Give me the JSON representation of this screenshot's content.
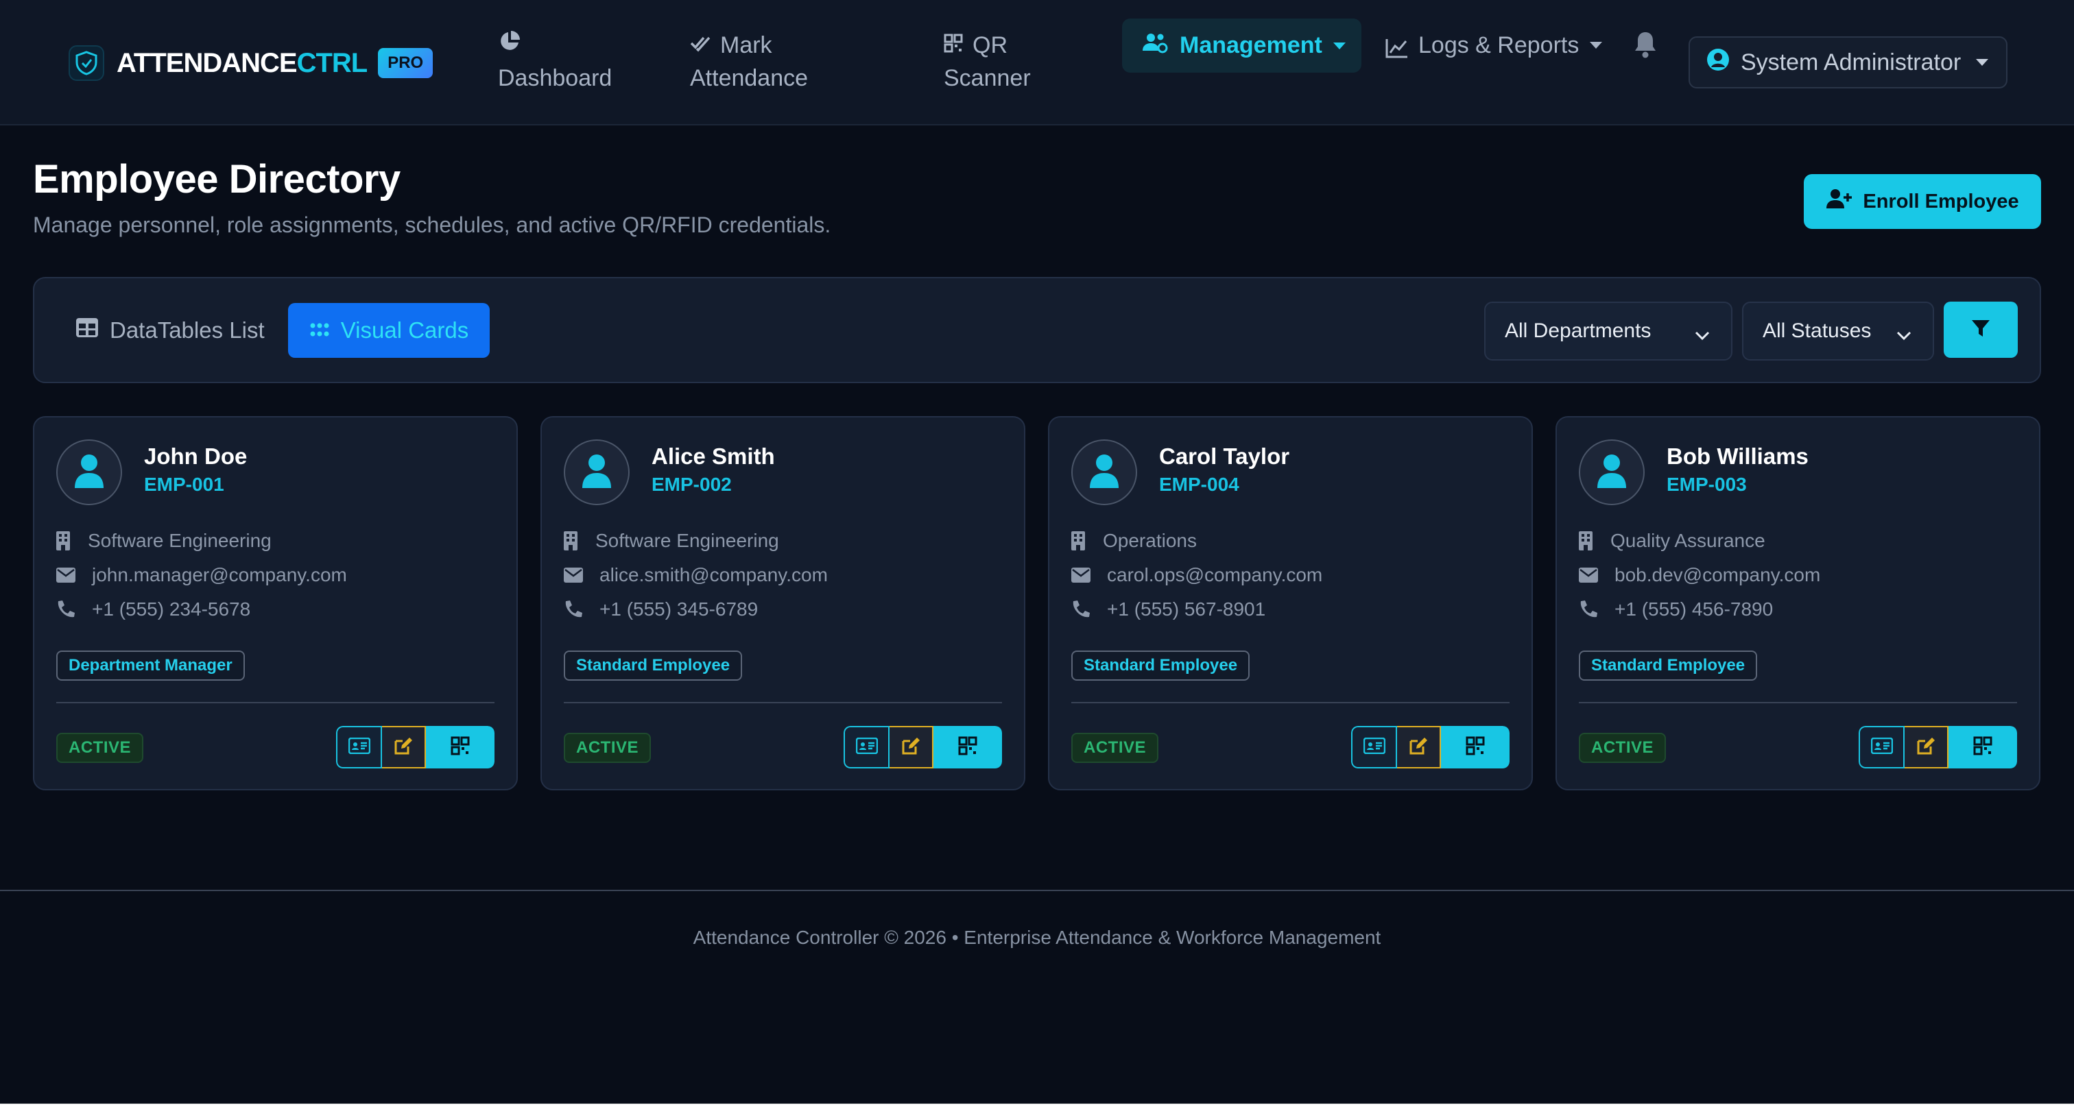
{
  "brand": {
    "name_main": "ATTENDANCE",
    "name_accent": "CTRL",
    "badge": "PRO"
  },
  "nav": {
    "dashboard": [
      "Dashboard"
    ],
    "mark_attendance": [
      "Mark",
      "Attendance"
    ],
    "qr_scanner": [
      "QR",
      "Scanner"
    ],
    "management": "Management",
    "logs_reports": "Logs & Reports",
    "user": "System Administrator"
  },
  "header": {
    "title": "Employee Directory",
    "subtitle": "Manage personnel, role assignments, schedules, and active QR/RFID credentials.",
    "enroll_label": "Enroll Employee"
  },
  "toolbar": {
    "tab_list": "DataTables List",
    "tab_cards": "Visual Cards",
    "department_filter": "All Departments",
    "status_filter": "All Statuses"
  },
  "employees": [
    {
      "name": "John Doe",
      "id": "EMP-001",
      "department": "Software Engineering",
      "email": "john.manager@company.com",
      "phone": "+1 (555) 234-5678",
      "role": "Department Manager",
      "status": "ACTIVE"
    },
    {
      "name": "Alice Smith",
      "id": "EMP-002",
      "department": "Software Engineering",
      "email": "alice.smith@company.com",
      "phone": "+1 (555) 345-6789",
      "role": "Standard Employee",
      "status": "ACTIVE"
    },
    {
      "name": "Carol Taylor",
      "id": "EMP-004",
      "department": "Operations",
      "email": "carol.ops@company.com",
      "phone": "+1 (555) 567-8901",
      "role": "Standard Employee",
      "status": "ACTIVE"
    },
    {
      "name": "Bob Williams",
      "id": "EMP-003",
      "department": "Quality Assurance",
      "email": "bob.dev@company.com",
      "phone": "+1 (555) 456-7890",
      "role": "Standard Employee",
      "status": "ACTIVE"
    }
  ],
  "footer": {
    "text": "Attendance Controller © 2026 • Enterprise Attendance & Workforce Management"
  },
  "colors": {
    "accent": "#18c6e4",
    "primary": "#0f6ff2",
    "warning": "#e0b023",
    "success": "#2bb673",
    "background": "#080d18"
  },
  "icons": [
    "shield-logo-icon",
    "pie-chart-icon",
    "check-double-icon",
    "qrcode-icon",
    "users-cog-icon",
    "line-chart-icon",
    "bell-icon",
    "user-circle-icon",
    "user-plus-icon",
    "table-icon",
    "grid-icon",
    "chevron-down-icon",
    "filter-icon",
    "user-icon",
    "building-icon",
    "envelope-icon",
    "phone-icon",
    "id-card-icon",
    "edit-icon"
  ]
}
